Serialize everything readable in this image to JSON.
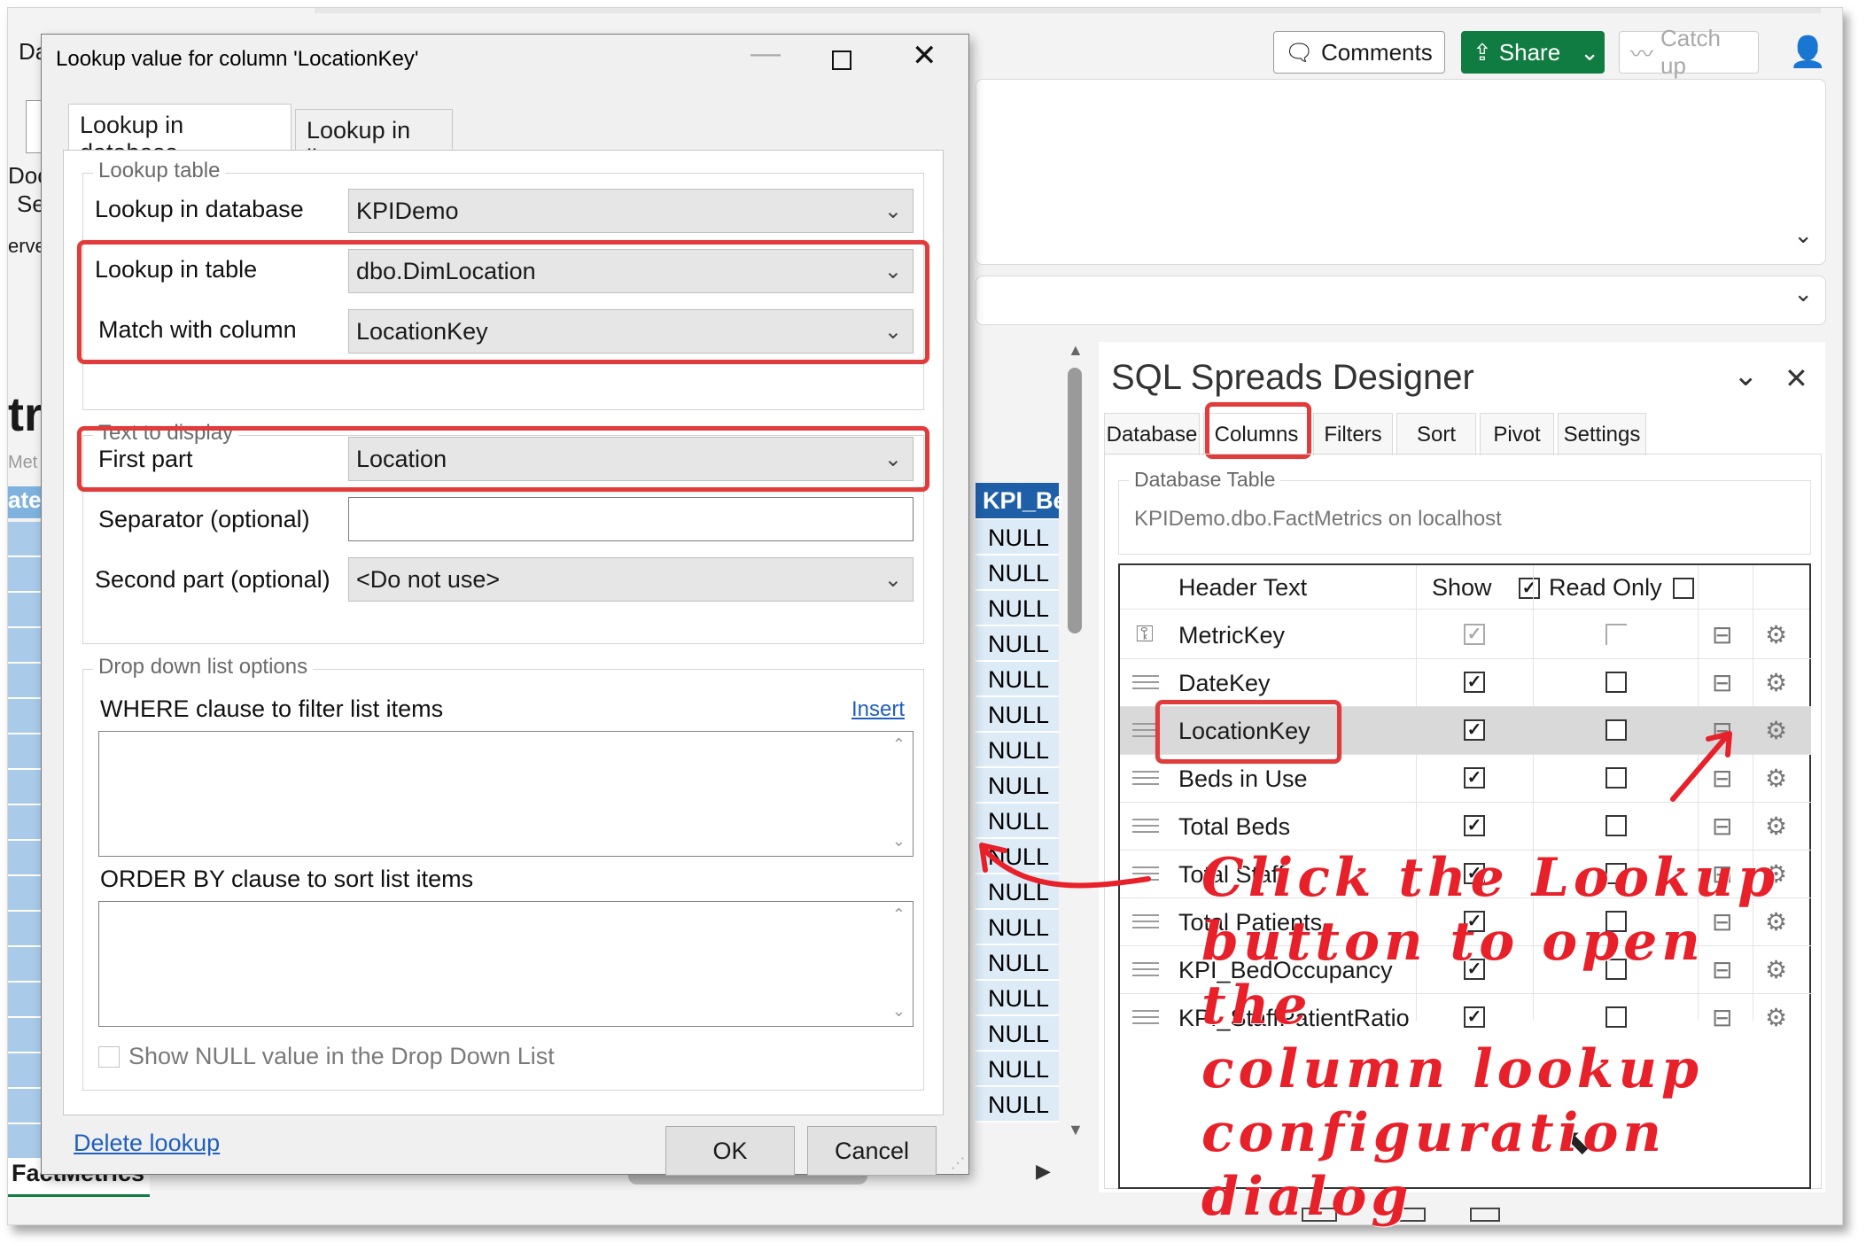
{
  "excel": {
    "toolbar": {
      "comments_label": "Comments",
      "share_label": "Share",
      "catch_up_label": "Catch up"
    },
    "sheet_cells": [
      "NULL",
      "NULL",
      "NULL",
      "NULL",
      "NULL",
      "NULL",
      "NULL",
      "NULL",
      "NULL",
      "NULL",
      "NULL",
      "NULL",
      "NULL",
      "NULL",
      "NULL",
      "NULL",
      "NULL"
    ],
    "col_header": "KPI_Be",
    "sheet_tab": "FactMetrics",
    "left_fragments": [
      "Da",
      "Doc",
      "Se",
      "erve",
      "tr",
      "Met",
      "ate"
    ]
  },
  "dialog": {
    "title": "Lookup value for column 'LocationKey'",
    "tabs": [
      "Lookup in database",
      "Lookup in list"
    ],
    "lookup_table_group": "Lookup table",
    "lookup_in_database_label": "Lookup in database",
    "lookup_in_database_value": "KPIDemo",
    "lookup_in_table_label": "Lookup in table",
    "lookup_in_table_value": "dbo.DimLocation",
    "match_with_column_label": "Match with column",
    "match_with_column_value": "LocationKey",
    "text_to_display_group": "Text to display",
    "first_part_label": "First part",
    "first_part_value": "Location",
    "separator_label": "Separator (optional)",
    "separator_value": "",
    "second_part_label": "Second part (optional)",
    "second_part_value": "<Do not use>",
    "dropdown_group": "Drop down list options",
    "where_label": "WHERE clause to filter list items",
    "insert_link": "Insert",
    "order_by_label": "ORDER BY clause to sort list items",
    "show_null_label": "Show NULL value in the Drop Down List",
    "delete_lookup": "Delete lookup",
    "ok": "OK",
    "cancel": "Cancel"
  },
  "designer": {
    "title": "SQL Spreads Designer",
    "tabs": [
      "Database",
      "Columns",
      "Filters",
      "Sort",
      "Pivot",
      "Settings"
    ],
    "active_tab": "Columns",
    "database_table_group": "Database Table",
    "database_table_value": "KPIDemo.dbo.FactMetrics on localhost",
    "grid_headers": {
      "header_text": "Header Text",
      "show": "Show",
      "read_only": "Read Only"
    },
    "rows": [
      {
        "name": "MetricKey",
        "show": true,
        "read_only": false,
        "key": true
      },
      {
        "name": "DateKey",
        "show": true,
        "read_only": false
      },
      {
        "name": "LocationKey",
        "show": true,
        "read_only": false,
        "selected": true
      },
      {
        "name": "Beds in Use",
        "show": true,
        "read_only": false
      },
      {
        "name": "Total Beds",
        "show": true,
        "read_only": false
      },
      {
        "name": "Total Staff",
        "show": true,
        "read_only": false
      },
      {
        "name": "Total Patients",
        "show": true,
        "read_only": false
      },
      {
        "name": "KPI_BedOccupancy",
        "show": true,
        "read_only": false
      },
      {
        "name": "KPI_StaffPatientRatio",
        "show": true,
        "read_only": false
      }
    ]
  },
  "annotation": {
    "lines": [
      "Click the Lookup",
      "button to open the",
      "column lookup",
      "configuration dialog"
    ],
    "color": "#e8202a"
  }
}
